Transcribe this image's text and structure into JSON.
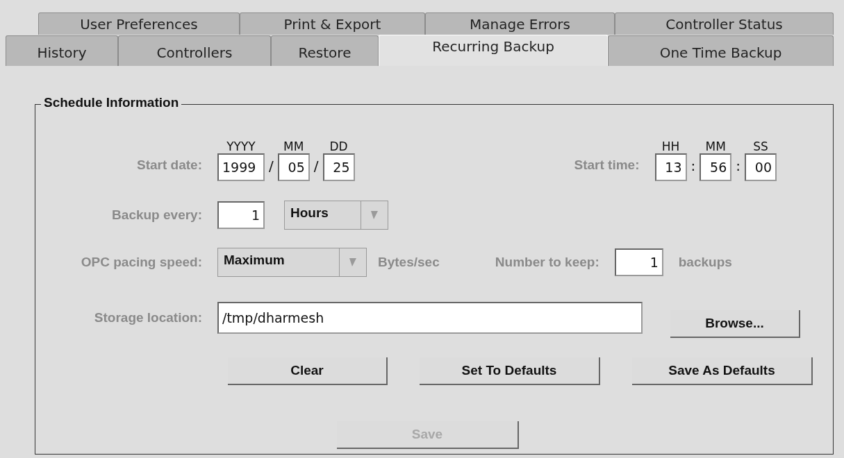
{
  "tabs_back": [
    {
      "label": "User Preferences",
      "selected": false
    },
    {
      "label": "Print & Export",
      "selected": false
    },
    {
      "label": "Manage Errors",
      "selected": false
    },
    {
      "label": "Controller Status",
      "selected": false
    }
  ],
  "tabs_front": [
    {
      "label": "History",
      "selected": false
    },
    {
      "label": "Controllers",
      "selected": false
    },
    {
      "label": "Restore",
      "selected": false
    },
    {
      "label": "Recurring Backup",
      "selected": true
    },
    {
      "label": "One Time Backup",
      "selected": false
    }
  ],
  "group": {
    "title": "Schedule Information"
  },
  "start_date": {
    "label": "Start date:",
    "parts": [
      {
        "heading": "YYYY",
        "value": "1999"
      },
      {
        "heading": "MM",
        "value": "05"
      },
      {
        "heading": "DD",
        "value": "25"
      }
    ],
    "separators": [
      "/",
      "/"
    ]
  },
  "start_time": {
    "label": "Start time:",
    "parts": [
      {
        "heading": "HH",
        "value": "13"
      },
      {
        "heading": "MM",
        "value": "56"
      },
      {
        "heading": "SS",
        "value": "00"
      }
    ],
    "separators": [
      ":",
      ":"
    ]
  },
  "backup_every": {
    "label": "Backup every:",
    "value": "1",
    "unit": "Hours"
  },
  "pacing": {
    "label": "OPC pacing speed:",
    "value": "Maximum",
    "unit": "Bytes/sec"
  },
  "keep": {
    "label": "Number to keep:",
    "value": "1",
    "unit": "backups"
  },
  "storage": {
    "label": "Storage location:",
    "value": "/tmp/dharmesh",
    "browse": "Browse..."
  },
  "buttons": [
    {
      "label": "Clear",
      "disabled": false
    },
    {
      "label": "Set To Defaults",
      "disabled": false
    },
    {
      "label": "Save As Defaults",
      "disabled": false
    }
  ],
  "save": {
    "label": "Save",
    "disabled": true
  }
}
